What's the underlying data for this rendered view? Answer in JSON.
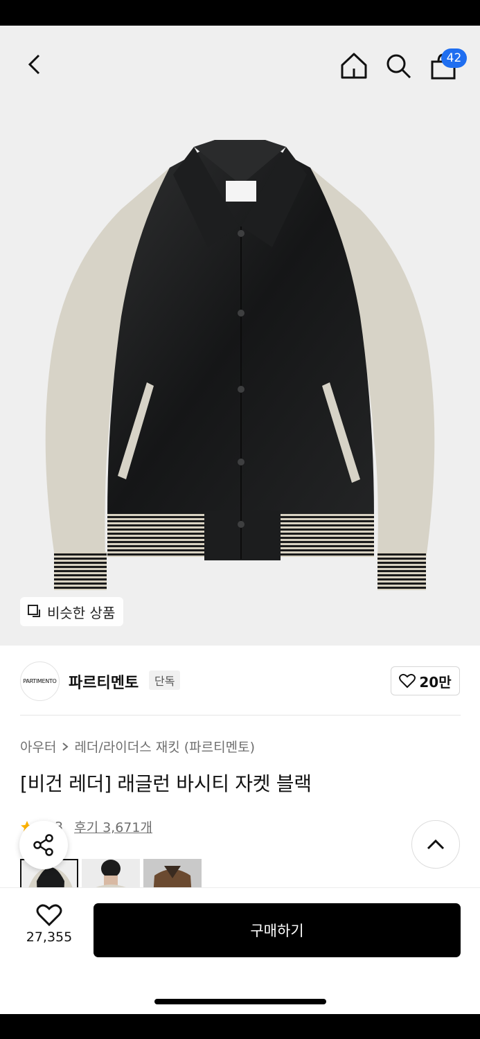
{
  "header": {
    "back_icon": "chevron-left-icon",
    "home_icon": "home-icon",
    "search_icon": "search-icon",
    "cart_icon": "shopping-bag-icon",
    "cart_count": "42"
  },
  "hero": {
    "similar_label": "비슷한 상품",
    "similar_icon": "copy-icon"
  },
  "brand": {
    "logo_text": "PARTIMENTO",
    "name": "파르티멘토",
    "tag": "단독",
    "likes": "20만"
  },
  "product": {
    "category": "아우터",
    "subcategory": "레더/라이더스 재킷 (파르티멘토)",
    "title": "[비건 레더] 래글런 바시티 자켓 블랙",
    "rating_partial": "3",
    "reviews": "후기 3,671개"
  },
  "bottom": {
    "wish_count": "27,355",
    "buy_label": "구매하기"
  },
  "colors": {
    "badge": "#1f6ef0",
    "star": "#ffb400",
    "buy_button": "#000000"
  }
}
